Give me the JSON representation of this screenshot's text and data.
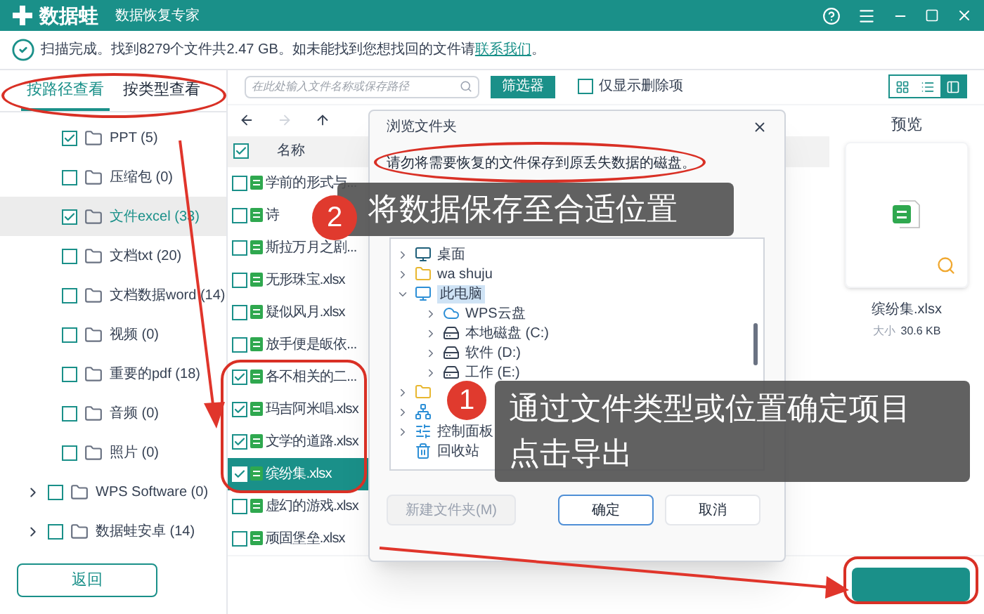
{
  "app": {
    "name": "数据蛙",
    "subtitle": "数据恢复专家"
  },
  "status": {
    "message": "扫描完成。找到8279个文件共2.47 GB。如未能找到您想找回的文件请",
    "link": "联系我们",
    "end": "。"
  },
  "view_tabs": [
    {
      "label": "按路径查看",
      "selected": true
    },
    {
      "label": "按类型查看",
      "selected": false
    }
  ],
  "folder_tree": [
    {
      "label": "PPT (5)",
      "checked": true,
      "selected": false
    },
    {
      "label": "压缩包 (0)",
      "checked": false,
      "selected": false
    },
    {
      "label": "文件excel (33)",
      "checked": true,
      "selected": true
    },
    {
      "label": "文档txt (20)",
      "checked": false,
      "selected": false
    },
    {
      "label": "文档数据word (14)",
      "checked": false,
      "selected": false
    },
    {
      "label": "视频 (0)",
      "checked": false,
      "selected": false
    },
    {
      "label": "重要的pdf (18)",
      "checked": false,
      "selected": false
    },
    {
      "label": "音频 (0)",
      "checked": false,
      "selected": false
    },
    {
      "label": "照片 (0)",
      "checked": false,
      "selected": false
    },
    {
      "label": "WPS Software (0)",
      "checked": false,
      "selected": false,
      "expanded": false
    },
    {
      "label": "数据蛙安卓 (14)",
      "checked": false,
      "selected": false,
      "expanded": false
    }
  ],
  "back_button": "返回",
  "toolbar": {
    "search_placeholder": "在此处输入文件名称或保存路径",
    "filter_button": "筛选器",
    "deleted_only": {
      "label": "仅显示删除项",
      "checked": false
    },
    "views": [
      {
        "kind": "grid",
        "selected": false
      },
      {
        "kind": "list",
        "selected": false
      },
      {
        "kind": "detail",
        "selected": true
      }
    ]
  },
  "file_list": {
    "header": "名称",
    "header_checked": true,
    "rows": [
      {
        "name": "学前的形式与...",
        "checked": false,
        "selected": false
      },
      {
        "name": "诗",
        "checked": false,
        "selected": false
      },
      {
        "name": "斯拉万月之剧...",
        "checked": false,
        "selected": false
      },
      {
        "name": "无形珠宝.xlsx",
        "checked": false,
        "selected": false
      },
      {
        "name": "疑似风月.xlsx",
        "checked": false,
        "selected": false
      },
      {
        "name": "放手便是皈依...",
        "checked": false,
        "selected": false
      },
      {
        "name": "各不相关的二...",
        "checked": true,
        "selected": false
      },
      {
        "name": "玛吉阿米唱.xlsx",
        "checked": true,
        "selected": false
      },
      {
        "name": "文学的道路.xlsx",
        "checked": true,
        "selected": false
      },
      {
        "name": "缤纷集.xlsx",
        "checked": true,
        "selected": true
      },
      {
        "name": "虚幻的游戏.xlsx",
        "checked": false,
        "selected": false
      },
      {
        "name": "顽固堡垒.xlsx",
        "checked": false,
        "selected": false
      }
    ]
  },
  "preview": {
    "title": "预览",
    "file_name": "缤纷集.xlsx",
    "size_label": "大小",
    "size": "30.6 KB"
  },
  "dialog": {
    "title": "浏览文件夹",
    "warning": "请勿将需要恢复的文件保存到原丢失数据的磁盘。",
    "tree": [
      {
        "label": "桌面",
        "kind": "desktop",
        "expanded": false
      },
      {
        "label": "wa shuju",
        "kind": "folder",
        "expanded": false
      },
      {
        "label": "此电脑",
        "kind": "pc",
        "expanded": true,
        "children": [
          {
            "label": "WPS云盘",
            "kind": "cloud",
            "expanded": false
          },
          {
            "label": "本地磁盘 (C:)",
            "kind": "disk",
            "expanded": false
          },
          {
            "label": "软件 (D:)",
            "kind": "drive",
            "expanded": false
          },
          {
            "label": "工作 (E:)",
            "kind": "drive",
            "expanded": false
          }
        ]
      },
      {
        "kind": "folder",
        "expanded": false
      },
      {
        "kind": "network",
        "expanded": false
      },
      {
        "label": "控制面板",
        "kind": "control",
        "expanded": false
      },
      {
        "label": "回收站",
        "kind": "bin"
      }
    ],
    "buttons": [
      {
        "label": "新建文件夹(M)",
        "disabled": true,
        "primary": false
      },
      {
        "label": "确定",
        "disabled": false,
        "primary": true
      },
      {
        "label": "取消",
        "disabled": false,
        "primary": false
      }
    ]
  },
  "callouts": [
    {
      "number": "2",
      "lines": [
        "将数据保存至合适位置"
      ]
    },
    {
      "number": "1",
      "lines": [
        "通过文件类型或位置确定项目",
        "点击导出"
      ]
    }
  ]
}
